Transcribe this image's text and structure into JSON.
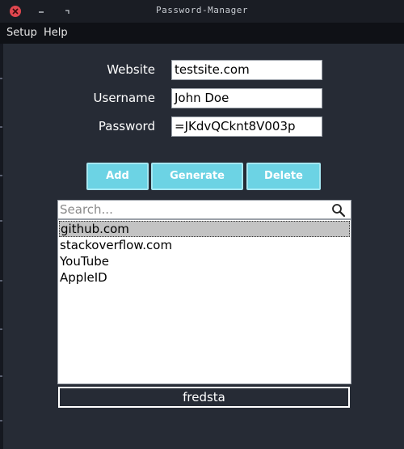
{
  "window": {
    "title": "Password-Manager",
    "min_glyph": "–",
    "max_glyph": "▫"
  },
  "menu": {
    "items": [
      {
        "label": "Setup"
      },
      {
        "label": "Help"
      }
    ]
  },
  "form": {
    "website_label": "Website",
    "website_value": "testsite.com",
    "username_label": "Username",
    "username_value": "John Doe",
    "password_label": "Password",
    "password_value": "=JKdvQCknt8V003p"
  },
  "buttons": {
    "add": "Add",
    "generate": "Generate",
    "delete": "Delete"
  },
  "search": {
    "placeholder": "Search..."
  },
  "list": {
    "items": [
      "github.com",
      "stackoverflow.com",
      "YouTube",
      "AppleID"
    ],
    "selected_index": 0
  },
  "footer": {
    "user": "fredsta"
  },
  "colors": {
    "button_bg": "#6cd3e4",
    "window_bg": "#262b35",
    "close_red": "#e0474f"
  }
}
